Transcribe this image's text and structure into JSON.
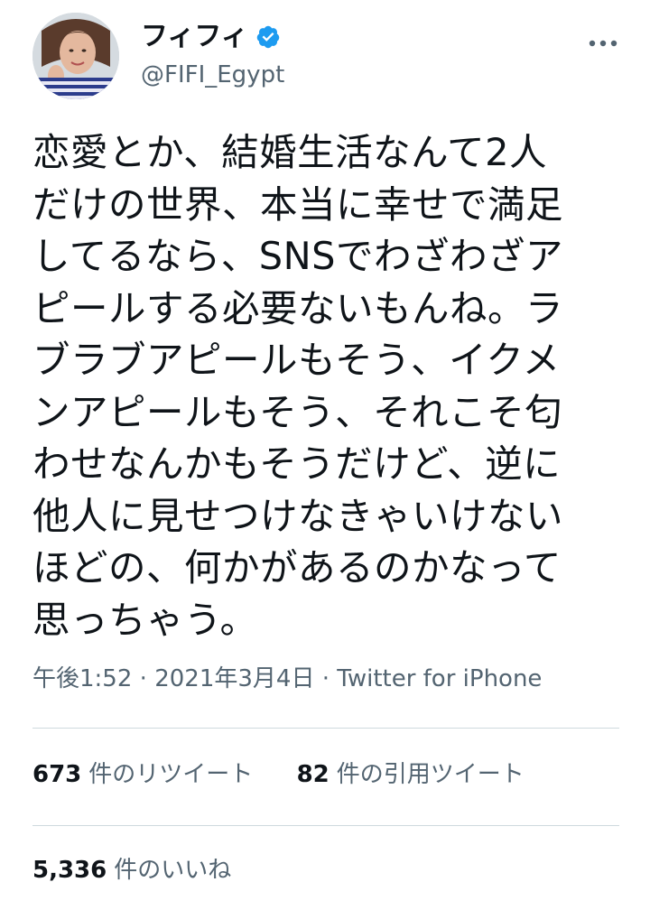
{
  "user": {
    "display_name": "フィフィ",
    "handle": "@FIFI_Egypt",
    "verified": true
  },
  "tweet": {
    "text": "恋愛とか、結婚生活なんて2人\nだけの世界、本当に幸せで満足\nしてるなら、SNSでわざわざア\nピールする必要ないもんね。ラ\nブラブアピールもそう、イクメ\nンアピールもそう、それこそ匂\nわせなんかもそうだけど、逆に\n他人に見せつけなきゃいけない\nほどの、何かがあるのかなって\n思っちゃう。",
    "time": "午後1:52",
    "separator1": "·",
    "date": "2021年3月4日",
    "separator2": "·",
    "source": "Twitter for iPhone"
  },
  "stats": {
    "retweets_count": "673",
    "retweets_label": "件のリツイート",
    "quotes_count": "82",
    "quotes_label": "件の引用ツイート",
    "likes_count": "5,336",
    "likes_label": "件のいいね"
  },
  "icons": {
    "verified": "verified-badge-icon",
    "more": "more-options-icon"
  },
  "colors": {
    "text_primary": "#0f1419",
    "text_secondary": "#536471",
    "verified_blue": "#1d9bf0",
    "divider": "#cfd9de"
  }
}
